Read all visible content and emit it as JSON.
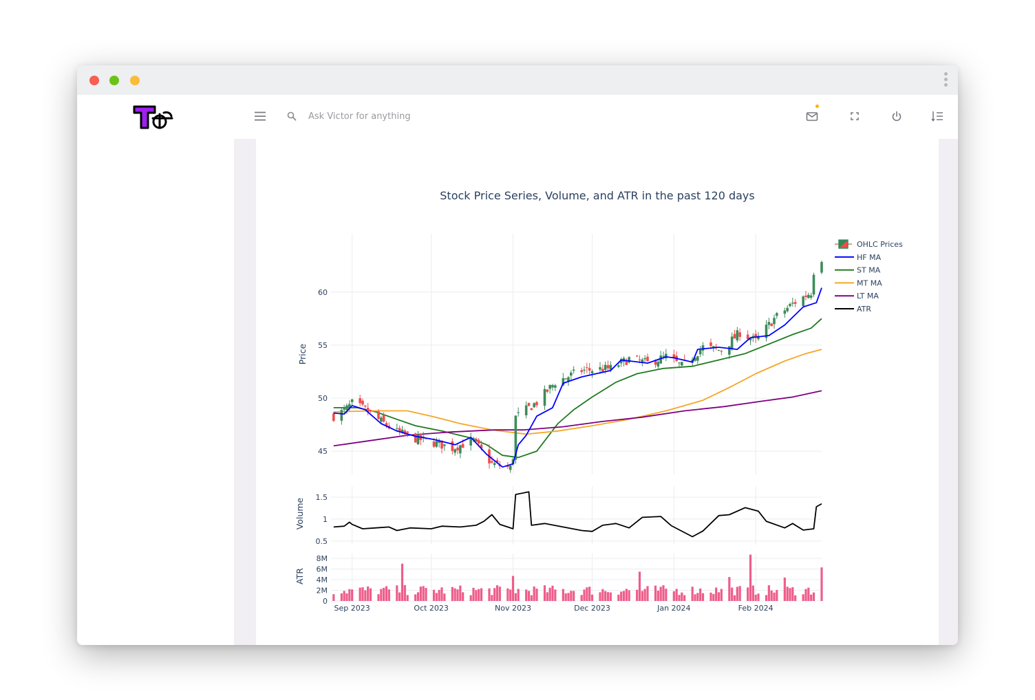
{
  "window": {
    "traffic_lights": [
      "#f95d53",
      "#6cc317",
      "#fbbb3b"
    ]
  },
  "appbar": {
    "search_placeholder": "Ask Victor for anything",
    "notification_dot_color": "#ffb300",
    "logo_colors": {
      "fill": "#a020f0",
      "outline": "#000000"
    }
  },
  "chart_data": {
    "type": "candlestick",
    "title": "Stock Price Series, Volume, and ATR in the past 120 days",
    "x_ticks": [
      {
        "date": "2023-09-01",
        "label": "Sep 2023"
      },
      {
        "date": "2023-10-01",
        "label": "Oct 2023"
      },
      {
        "date": "2023-11-01",
        "label": "Nov 2023"
      },
      {
        "date": "2023-12-01",
        "label": "Dec 2023"
      },
      {
        "date": "2024-01-01",
        "label": "Jan 2024"
      },
      {
        "date": "2024-02-01",
        "label": "Feb 2024"
      }
    ],
    "x_range": [
      "2023-08-24",
      "2024-02-26"
    ],
    "panels": {
      "price": {
        "ylabel": "Price",
        "ylim": [
          42.8,
          65.5
        ],
        "ticks": [
          {
            "v": 45,
            "label": "45"
          },
          {
            "v": 50,
            "label": "50"
          },
          {
            "v": 55,
            "label": "55"
          },
          {
            "v": 60,
            "label": "60"
          }
        ]
      },
      "volume": {
        "ylabel": "Volume",
        "ylim": [
          0.42,
          1.75
        ],
        "ticks": [
          {
            "v": 0.5,
            "label": "0.5"
          },
          {
            "v": 1,
            "label": "1"
          },
          {
            "v": 1.5,
            "label": "1.5"
          }
        ]
      },
      "atr": {
        "ylabel": "ATR",
        "ylim": [
          0,
          8900000
        ],
        "ticks": [
          {
            "v": 0,
            "label": "0"
          },
          {
            "v": 2000000,
            "label": "2M"
          },
          {
            "v": 4000000,
            "label": "4M"
          },
          {
            "v": 6000000,
            "label": "6M"
          },
          {
            "v": 8000000,
            "label": "8M"
          }
        ]
      }
    },
    "legend": {
      "placement": "top-right",
      "items": [
        {
          "name": "OHLC Prices",
          "color": "#2e8b57",
          "kind": "candle"
        },
        {
          "name": "HF MA",
          "color": "#0000ff",
          "kind": "line"
        },
        {
          "name": "ST MA",
          "color": "#1f7a1f",
          "kind": "line"
        },
        {
          "name": "MT MA",
          "color": "#f5a623",
          "kind": "line"
        },
        {
          "name": "LT MA",
          "color": "#800080",
          "kind": "line"
        },
        {
          "name": "ATR",
          "color": "#000000",
          "kind": "line"
        }
      ]
    },
    "colors": {
      "up": "#3d8b5a",
      "down": "#ef4d4d",
      "bar": "#ee5d8a",
      "grid": "#ebecf1"
    },
    "grid": true,
    "candles": {
      "start": "2023-08-25",
      "end": "2024-02-26",
      "close_anchors": [
        {
          "date": "2023-08-25",
          "v": 48.3
        },
        {
          "date": "2023-08-29",
          "v": 48.8
        },
        {
          "date": "2023-09-01",
          "v": 49.5
        },
        {
          "date": "2023-09-06",
          "v": 48.9
        },
        {
          "date": "2023-09-12",
          "v": 47.8
        },
        {
          "date": "2023-09-18",
          "v": 46.8
        },
        {
          "date": "2023-09-25",
          "v": 46.2
        },
        {
          "date": "2023-10-02",
          "v": 45.8
        },
        {
          "date": "2023-10-09",
          "v": 45.3
        },
        {
          "date": "2023-10-17",
          "v": 46.0
        },
        {
          "date": "2023-10-24",
          "v": 43.8
        },
        {
          "date": "2023-10-31",
          "v": 43.4
        },
        {
          "date": "2023-11-01",
          "v": 44.5
        },
        {
          "date": "2023-11-02",
          "v": 48.2
        },
        {
          "date": "2023-11-10",
          "v": 49.6
        },
        {
          "date": "2023-11-17",
          "v": 51.5
        },
        {
          "date": "2023-11-27",
          "v": 52.6
        },
        {
          "date": "2023-12-08",
          "v": 52.8
        },
        {
          "date": "2023-12-15",
          "v": 53.7
        },
        {
          "date": "2023-12-22",
          "v": 53.3
        },
        {
          "date": "2023-12-29",
          "v": 53.9
        },
        {
          "date": "2024-01-04",
          "v": 53.0
        },
        {
          "date": "2024-01-12",
          "v": 54.8
        },
        {
          "date": "2024-01-19",
          "v": 54.5
        },
        {
          "date": "2024-01-26",
          "v": 56.2
        },
        {
          "date": "2024-02-01",
          "v": 55.4
        },
        {
          "date": "2024-02-08",
          "v": 57.5
        },
        {
          "date": "2024-02-15",
          "v": 58.9
        },
        {
          "date": "2024-02-22",
          "v": 60.0
        },
        {
          "date": "2024-02-23",
          "v": 62.0
        },
        {
          "date": "2024-02-26",
          "v": 63.2
        }
      ]
    },
    "series": [
      {
        "name": "HF MA",
        "color": "#0000ff",
        "points": [
          {
            "date": "2023-08-25",
            "v": 48.6
          },
          {
            "date": "2023-08-29",
            "v": 48.5
          },
          {
            "date": "2023-09-01",
            "v": 49.3
          },
          {
            "date": "2023-09-06",
            "v": 48.9
          },
          {
            "date": "2023-09-12",
            "v": 47.6
          },
          {
            "date": "2023-09-18",
            "v": 46.9
          },
          {
            "date": "2023-09-25",
            "v": 46.4
          },
          {
            "date": "2023-10-02",
            "v": 46.1
          },
          {
            "date": "2023-10-10",
            "v": 45.6
          },
          {
            "date": "2023-10-16",
            "v": 46.3
          },
          {
            "date": "2023-10-22",
            "v": 44.7
          },
          {
            "date": "2023-10-28",
            "v": 43.5
          },
          {
            "date": "2023-11-01",
            "v": 43.8
          },
          {
            "date": "2023-11-03",
            "v": 45.6
          },
          {
            "date": "2023-11-06",
            "v": 46.5
          },
          {
            "date": "2023-11-10",
            "v": 48.3
          },
          {
            "date": "2023-11-16",
            "v": 49.1
          },
          {
            "date": "2023-11-20",
            "v": 51.4
          },
          {
            "date": "2023-11-27",
            "v": 52.0
          },
          {
            "date": "2023-12-08",
            "v": 52.6
          },
          {
            "date": "2023-12-12",
            "v": 53.6
          },
          {
            "date": "2023-12-22",
            "v": 53.3
          },
          {
            "date": "2023-12-29",
            "v": 53.9
          },
          {
            "date": "2024-01-01",
            "v": 53.8
          },
          {
            "date": "2024-01-08",
            "v": 53.4
          },
          {
            "date": "2024-01-10",
            "v": 54.6
          },
          {
            "date": "2024-01-18",
            "v": 54.8
          },
          {
            "date": "2024-01-25",
            "v": 54.6
          },
          {
            "date": "2024-01-30",
            "v": 55.7
          },
          {
            "date": "2024-02-06",
            "v": 55.9
          },
          {
            "date": "2024-02-12",
            "v": 56.9
          },
          {
            "date": "2024-02-19",
            "v": 58.6
          },
          {
            "date": "2024-02-24",
            "v": 59.0
          },
          {
            "date": "2024-02-26",
            "v": 60.4
          }
        ]
      },
      {
        "name": "ST MA",
        "color": "#1f7a1f",
        "points": [
          {
            "date": "2023-08-25",
            "v": 49.1
          },
          {
            "date": "2023-09-03",
            "v": 49.1
          },
          {
            "date": "2023-09-10",
            "v": 48.7
          },
          {
            "date": "2023-09-18",
            "v": 48.0
          },
          {
            "date": "2023-09-25",
            "v": 47.4
          },
          {
            "date": "2023-10-05",
            "v": 46.9
          },
          {
            "date": "2023-10-15",
            "v": 46.3
          },
          {
            "date": "2023-10-22",
            "v": 45.6
          },
          {
            "date": "2023-10-28",
            "v": 44.6
          },
          {
            "date": "2023-11-03",
            "v": 44.4
          },
          {
            "date": "2023-11-10",
            "v": 45.0
          },
          {
            "date": "2023-11-18",
            "v": 47.6
          },
          {
            "date": "2023-11-24",
            "v": 48.9
          },
          {
            "date": "2023-12-01",
            "v": 50.1
          },
          {
            "date": "2023-12-10",
            "v": 51.5
          },
          {
            "date": "2023-12-18",
            "v": 52.3
          },
          {
            "date": "2023-12-28",
            "v": 52.8
          },
          {
            "date": "2024-01-08",
            "v": 53.0
          },
          {
            "date": "2024-01-18",
            "v": 53.6
          },
          {
            "date": "2024-01-28",
            "v": 54.2
          },
          {
            "date": "2024-02-05",
            "v": 55.0
          },
          {
            "date": "2024-02-15",
            "v": 56.0
          },
          {
            "date": "2024-02-22",
            "v": 56.6
          },
          {
            "date": "2024-02-26",
            "v": 57.5
          }
        ]
      },
      {
        "name": "MT MA",
        "color": "#f5a623",
        "points": [
          {
            "date": "2023-08-25",
            "v": 48.7
          },
          {
            "date": "2023-09-08",
            "v": 48.8
          },
          {
            "date": "2023-09-22",
            "v": 48.8
          },
          {
            "date": "2023-10-01",
            "v": 48.3
          },
          {
            "date": "2023-10-12",
            "v": 47.6
          },
          {
            "date": "2023-10-24",
            "v": 47.0
          },
          {
            "date": "2023-11-06",
            "v": 46.6
          },
          {
            "date": "2023-11-18",
            "v": 46.9
          },
          {
            "date": "2023-12-01",
            "v": 47.4
          },
          {
            "date": "2023-12-15",
            "v": 48.0
          },
          {
            "date": "2023-12-29",
            "v": 48.8
          },
          {
            "date": "2024-01-12",
            "v": 49.8
          },
          {
            "date": "2024-01-22",
            "v": 51.0
          },
          {
            "date": "2024-02-01",
            "v": 52.3
          },
          {
            "date": "2024-02-12",
            "v": 53.5
          },
          {
            "date": "2024-02-20",
            "v": 54.2
          },
          {
            "date": "2024-02-26",
            "v": 54.6
          }
        ]
      },
      {
        "name": "LT MA",
        "color": "#800080",
        "points": [
          {
            "date": "2023-08-25",
            "v": 45.5
          },
          {
            "date": "2023-09-08",
            "v": 46.0
          },
          {
            "date": "2023-09-22",
            "v": 46.5
          },
          {
            "date": "2023-10-08",
            "v": 46.8
          },
          {
            "date": "2023-10-25",
            "v": 47.0
          },
          {
            "date": "2023-11-05",
            "v": 47.0
          },
          {
            "date": "2023-11-20",
            "v": 47.3
          },
          {
            "date": "2023-12-05",
            "v": 47.8
          },
          {
            "date": "2023-12-20",
            "v": 48.2
          },
          {
            "date": "2024-01-05",
            "v": 48.8
          },
          {
            "date": "2024-01-20",
            "v": 49.2
          },
          {
            "date": "2024-02-03",
            "v": 49.7
          },
          {
            "date": "2024-02-15",
            "v": 50.1
          },
          {
            "date": "2024-02-26",
            "v": 50.7
          }
        ]
      },
      {
        "name": "ATR",
        "color": "#000000",
        "panel": "volume",
        "points": [
          {
            "date": "2023-08-25",
            "v": 0.82
          },
          {
            "date": "2023-08-29",
            "v": 0.84
          },
          {
            "date": "2023-08-31",
            "v": 0.93
          },
          {
            "date": "2023-09-01",
            "v": 0.88
          },
          {
            "date": "2023-09-05",
            "v": 0.78
          },
          {
            "date": "2023-09-10",
            "v": 0.8
          },
          {
            "date": "2023-09-15",
            "v": 0.82
          },
          {
            "date": "2023-09-18",
            "v": 0.74
          },
          {
            "date": "2023-09-23",
            "v": 0.8
          },
          {
            "date": "2023-10-01",
            "v": 0.78
          },
          {
            "date": "2023-10-05",
            "v": 0.84
          },
          {
            "date": "2023-10-12",
            "v": 0.82
          },
          {
            "date": "2023-10-18",
            "v": 0.86
          },
          {
            "date": "2023-10-21",
            "v": 0.95
          },
          {
            "date": "2023-10-24",
            "v": 1.1
          },
          {
            "date": "2023-10-27",
            "v": 0.88
          },
          {
            "date": "2023-10-30",
            "v": 0.82
          },
          {
            "date": "2023-11-01",
            "v": 0.78
          },
          {
            "date": "2023-11-02",
            "v": 1.56
          },
          {
            "date": "2023-11-07",
            "v": 1.62
          },
          {
            "date": "2023-11-08",
            "v": 0.86
          },
          {
            "date": "2023-11-13",
            "v": 0.9
          },
          {
            "date": "2023-11-20",
            "v": 0.82
          },
          {
            "date": "2023-11-27",
            "v": 0.74
          },
          {
            "date": "2023-12-01",
            "v": 0.72
          },
          {
            "date": "2023-12-05",
            "v": 0.86
          },
          {
            "date": "2023-12-10",
            "v": 0.9
          },
          {
            "date": "2023-12-15",
            "v": 0.8
          },
          {
            "date": "2023-12-20",
            "v": 1.04
          },
          {
            "date": "2023-12-27",
            "v": 1.06
          },
          {
            "date": "2023-12-31",
            "v": 0.85
          },
          {
            "date": "2024-01-08",
            "v": 0.6
          },
          {
            "date": "2024-01-12",
            "v": 0.73
          },
          {
            "date": "2024-01-18",
            "v": 1.08
          },
          {
            "date": "2024-01-22",
            "v": 1.1
          },
          {
            "date": "2024-01-28",
            "v": 1.26
          },
          {
            "date": "2024-02-02",
            "v": 1.18
          },
          {
            "date": "2024-02-05",
            "v": 0.95
          },
          {
            "date": "2024-02-12",
            "v": 0.8
          },
          {
            "date": "2024-02-15",
            "v": 0.9
          },
          {
            "date": "2024-02-19",
            "v": 0.75
          },
          {
            "date": "2024-02-23",
            "v": 0.78
          },
          {
            "date": "2024-02-24",
            "v": 1.28
          },
          {
            "date": "2024-02-26",
            "v": 1.35
          }
        ]
      }
    ],
    "volume_bars": {
      "color": "#ee5d8a",
      "typical": 2300000,
      "spikes": [
        {
          "date": "2023-09-20",
          "v": 7000000
        },
        {
          "date": "2023-11-01",
          "v": 4700000
        },
        {
          "date": "2023-12-19",
          "v": 5500000
        },
        {
          "date": "2024-01-30",
          "v": 8700000
        },
        {
          "date": "2024-02-26",
          "v": 6300000
        },
        {
          "date": "2024-02-12",
          "v": 4400000
        },
        {
          "date": "2024-01-22",
          "v": 4500000
        }
      ]
    }
  }
}
